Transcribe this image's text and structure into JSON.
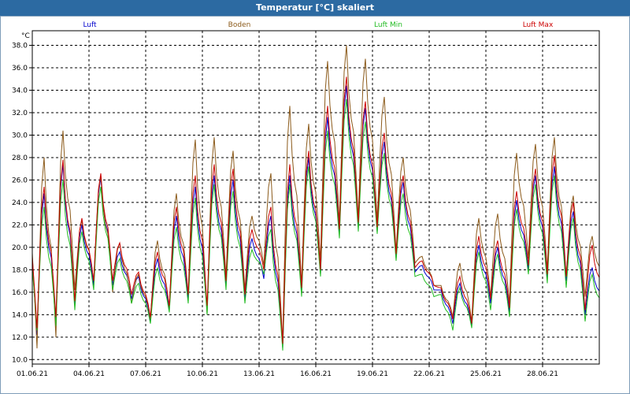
{
  "window": {
    "title": "Temperatur [°C] skaliert"
  },
  "chart_data": {
    "type": "line",
    "title": "Temperatur [°C] skaliert",
    "ylabel": "°C",
    "ylim": [
      9.6,
      39.3
    ],
    "yticks": [
      10.0,
      12.0,
      14.0,
      16.0,
      18.0,
      20.0,
      22.0,
      24.0,
      26.0,
      28.0,
      30.0,
      32.0,
      34.0,
      36.0,
      38.0
    ],
    "xlim": [
      0,
      30
    ],
    "xticks": [
      {
        "x": 0,
        "label": "01.06.21"
      },
      {
        "x": 3,
        "label": "04.06.21"
      },
      {
        "x": 6,
        "label": "07.06.21"
      },
      {
        "x": 9,
        "label": "10.06.21"
      },
      {
        "x": 12,
        "label": "13.06.21"
      },
      {
        "x": 15,
        "label": "16.06.21"
      },
      {
        "x": 18,
        "label": "19.06.21"
      },
      {
        "x": 21,
        "label": "22.06.21"
      },
      {
        "x": 24,
        "label": "25.06.21"
      },
      {
        "x": 27,
        "label": "28.06.21"
      }
    ],
    "grid": true,
    "legend_position": "top",
    "series": [
      {
        "name": "Luft",
        "color": "#0000cc",
        "min": [
          12.2,
          13.4,
          14.8,
          16.6,
          16.6,
          15.4,
          13.4,
          14.4,
          15.4,
          14.4,
          16.6,
          15.4,
          17.2,
          11.0,
          16.0,
          17.6,
          21.2,
          21.8,
          21.4,
          19.0,
          17.8,
          16.2,
          13.2,
          13.0,
          15.0,
          14.2,
          18.0,
          17.2,
          17.0,
          14.0
        ],
        "max": [
          24.8,
          27.4,
          22.0,
          26.2,
          19.6,
          17.4,
          19.0,
          22.8,
          25.4,
          26.4,
          26.0,
          20.8,
          22.8,
          26.4,
          28.0,
          31.6,
          34.4,
          32.4,
          29.4,
          25.8,
          18.4,
          16.2,
          16.8,
          20.2,
          20.0,
          24.2,
          26.4,
          27.2,
          23.2,
          18.2
        ]
      },
      {
        "name": "Boden",
        "color": "#8b5a1a",
        "min": [
          11.0,
          12.0,
          16.2,
          17.0,
          16.0,
          15.0,
          13.6,
          14.6,
          15.8,
          14.0,
          17.4,
          16.2,
          18.4,
          11.6,
          16.6,
          18.8,
          22.2,
          22.6,
          22.4,
          19.6,
          18.6,
          16.6,
          13.8,
          13.4,
          15.6,
          15.0,
          19.0,
          18.0,
          17.4,
          15.6
        ],
        "max": [
          28.0,
          30.4,
          22.4,
          26.4,
          20.4,
          17.6,
          20.6,
          24.8,
          29.6,
          29.8,
          28.6,
          22.8,
          26.6,
          32.6,
          31.0,
          36.6,
          38.0,
          36.8,
          33.4,
          28.0,
          19.2,
          16.6,
          18.6,
          22.6,
          23.0,
          28.4,
          29.2,
          29.8,
          24.6,
          21.0
        ]
      },
      {
        "name": "Luft Min",
        "color": "#22bb22",
        "min": [
          12.6,
          13.0,
          14.4,
          16.2,
          16.2,
          15.0,
          13.2,
          14.2,
          15.0,
          14.0,
          16.2,
          15.0,
          17.6,
          10.8,
          15.6,
          17.4,
          20.8,
          21.4,
          21.2,
          18.8,
          17.4,
          15.6,
          12.6,
          12.8,
          14.4,
          13.8,
          17.6,
          16.8,
          16.4,
          13.4
        ],
        "max": [
          23.6,
          26.0,
          21.4,
          25.4,
          19.0,
          16.8,
          18.2,
          21.8,
          24.4,
          25.6,
          25.0,
          19.8,
          21.6,
          25.6,
          27.2,
          30.4,
          33.2,
          31.2,
          28.4,
          24.8,
          17.6,
          15.8,
          16.4,
          19.6,
          19.4,
          23.4,
          25.6,
          26.4,
          22.6,
          17.6
        ]
      },
      {
        "name": "Luft Max",
        "color": "#cc0000",
        "min": [
          12.8,
          13.8,
          15.2,
          17.0,
          17.0,
          15.8,
          13.8,
          14.8,
          15.8,
          14.8,
          17.0,
          15.8,
          18.0,
          11.4,
          16.4,
          18.0,
          21.6,
          22.2,
          21.8,
          19.4,
          18.2,
          16.6,
          13.6,
          13.2,
          15.4,
          14.6,
          18.4,
          17.6,
          17.4,
          14.4
        ],
        "max": [
          25.4,
          27.8,
          22.6,
          26.6,
          20.4,
          17.8,
          19.6,
          23.6,
          26.4,
          27.4,
          27.0,
          21.6,
          23.6,
          27.4,
          28.6,
          32.6,
          35.2,
          33.0,
          30.2,
          26.4,
          18.8,
          16.4,
          17.4,
          21.0,
          20.6,
          25.0,
          27.0,
          28.2,
          24.0,
          20.2
        ]
      }
    ]
  }
}
